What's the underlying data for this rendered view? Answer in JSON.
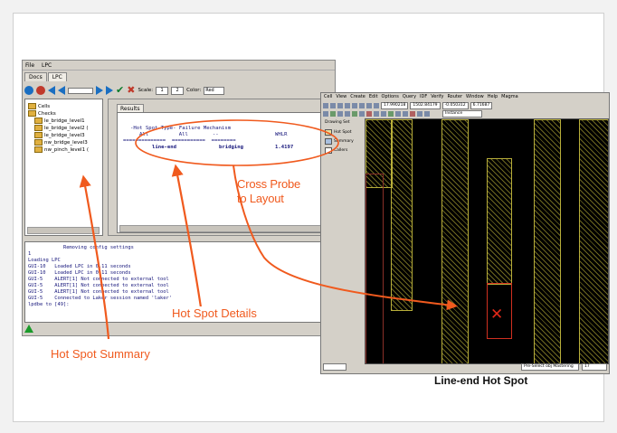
{
  "lpc_window": {
    "menu": [
      "File",
      "LPC"
    ],
    "tabs": [
      "Docs",
      "LPC"
    ],
    "toolbar": {
      "scale_label": "Scale:",
      "scale_value_1": "1",
      "scale_value_2": "2",
      "color_label": "Color:",
      "color_value": "Red"
    },
    "tree": [
      "Cells",
      "Checks",
      "le_bridge_level1",
      "le_bridge_level2 (",
      "le_bridge_level3",
      "nw_bridge_level3",
      "nw_pinch_level1 ("
    ],
    "results_tab": "Results",
    "results": {
      "header_line": "-Hot Spot Type- Failure Mechanism",
      "header_all": "All          All        --",
      "header_wlr": "WHLR",
      "separator": "==============  ===========  ========",
      "row": {
        "type": "line-end",
        "mechanism": "bridging",
        "value": "1.4197"
      }
    },
    "log": [
      "            Removing config settings",
      "1",
      "Loading LPC",
      "GUI-10   Loaded LPC in 0.11 seconds",
      "GUI-10   Loaded LPC in 0.11 seconds",
      "GUI-5    ALERT[1] Not connected to external tool",
      "GUI-5    ALERT[1] Not connected to external tool",
      "GUI-5    ALERT[1] Not connected to external tool",
      "GUI-5    Connected to Laker session named 'laker'",
      "lpdbe to [49]:"
    ]
  },
  "layout_window": {
    "menu": [
      "Cell",
      "View",
      "Create",
      "Edit",
      "Options",
      "Query",
      "IDF",
      "Verify",
      "Router",
      "Window",
      "Help",
      "Magma"
    ],
    "coords": [
      "17.990218",
      "1502.84179",
      "-0.050312",
      "6.71687"
    ],
    "instance_label": "Instance",
    "side_panel": [
      "Drawing Set",
      "Hot Spot",
      "Summary",
      "Callers"
    ],
    "status_text": "Pre-Select obj Mastering",
    "status_value": "17"
  },
  "annotations": {
    "cross_probe": [
      "Cross Probe",
      "to Layout"
    ],
    "hot_spot_details": "Hot Spot Details",
    "hot_spot_summary": "Hot Spot Summary",
    "caption": "Line-end Hot Spot"
  },
  "colors": {
    "annotation": "#f05a1e",
    "hotspot_marker": "#e02818",
    "layout_background": "#000000"
  }
}
